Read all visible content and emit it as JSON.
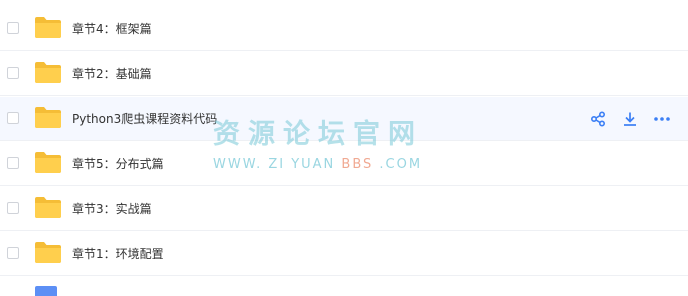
{
  "files": [
    {
      "name": "章节4：框架篇",
      "icon": "folder-icon",
      "hovered": false
    },
    {
      "name": "章节2：基础篇",
      "icon": "folder-icon",
      "hovered": false
    },
    {
      "name": "Python3爬虫课程资料代码",
      "icon": "folder-icon",
      "hovered": true
    },
    {
      "name": "章节5：分布式篇",
      "icon": "folder-icon",
      "hovered": false
    },
    {
      "name": "章节3：实战篇",
      "icon": "folder-icon",
      "hovered": false
    },
    {
      "name": "章节1：环境配置",
      "icon": "folder-icon",
      "hovered": false
    }
  ],
  "row_actions": {
    "share_icon": "share-icon",
    "download_icon": "download-icon",
    "more_icon": "more-icon"
  },
  "watermark": {
    "title": "资源论坛官网",
    "sub_part1": "WWW. ZI YUAN ",
    "sub_part2": "BBS",
    "sub_part3": " .COM"
  },
  "colors": {
    "folder": "#ffcf4d",
    "folder_tab": "#f5bd36",
    "accent": "#3b7ff5",
    "hover_bg": "#f5f8ff"
  }
}
